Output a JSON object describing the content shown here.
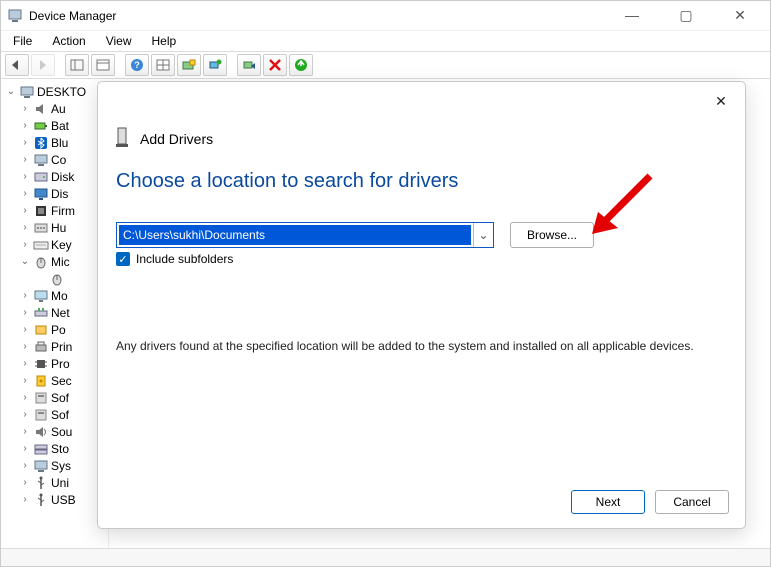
{
  "window": {
    "title": "Device Manager"
  },
  "menubar": {
    "items": [
      "File",
      "Action",
      "View",
      "Help"
    ]
  },
  "tree": {
    "root": "DESKTO",
    "nodes": [
      {
        "label": "Au",
        "icon": "audio"
      },
      {
        "label": "Bat",
        "icon": "battery"
      },
      {
        "label": "Blu",
        "icon": "bluetooth"
      },
      {
        "label": "Co",
        "icon": "computer"
      },
      {
        "label": "Disk",
        "icon": "disk"
      },
      {
        "label": "Dis",
        "icon": "display"
      },
      {
        "label": "Firm",
        "icon": "firmware"
      },
      {
        "label": "Hu",
        "icon": "hid"
      },
      {
        "label": "Key",
        "icon": "keyboard"
      },
      {
        "label": "Mic",
        "icon": "mouse",
        "expanded": true,
        "children": [
          {
            "label": "",
            "icon": "mouse"
          }
        ]
      },
      {
        "label": "Mo",
        "icon": "monitor"
      },
      {
        "label": "Net",
        "icon": "network"
      },
      {
        "label": "Po",
        "icon": "ports"
      },
      {
        "label": "Prin",
        "icon": "print"
      },
      {
        "label": "Pro",
        "icon": "processor"
      },
      {
        "label": "Sec",
        "icon": "security"
      },
      {
        "label": "Sof",
        "icon": "software"
      },
      {
        "label": "Sof",
        "icon": "software"
      },
      {
        "label": "Sou",
        "icon": "sound"
      },
      {
        "label": "Sto",
        "icon": "storage"
      },
      {
        "label": "Sys",
        "icon": "system"
      },
      {
        "label": "Uni",
        "icon": "usb"
      },
      {
        "label": "USB",
        "icon": "usb"
      }
    ]
  },
  "dialog": {
    "header": "Add Drivers",
    "title": "Choose a location to search for drivers",
    "path": "C:\\Users\\sukhi\\Documents",
    "browse": "Browse...",
    "include_subfolders_label": "Include subfolders",
    "include_subfolders_checked": true,
    "description": "Any drivers found at the specified location will be added to the system and installed on all applicable devices.",
    "next": "Next",
    "cancel": "Cancel"
  }
}
